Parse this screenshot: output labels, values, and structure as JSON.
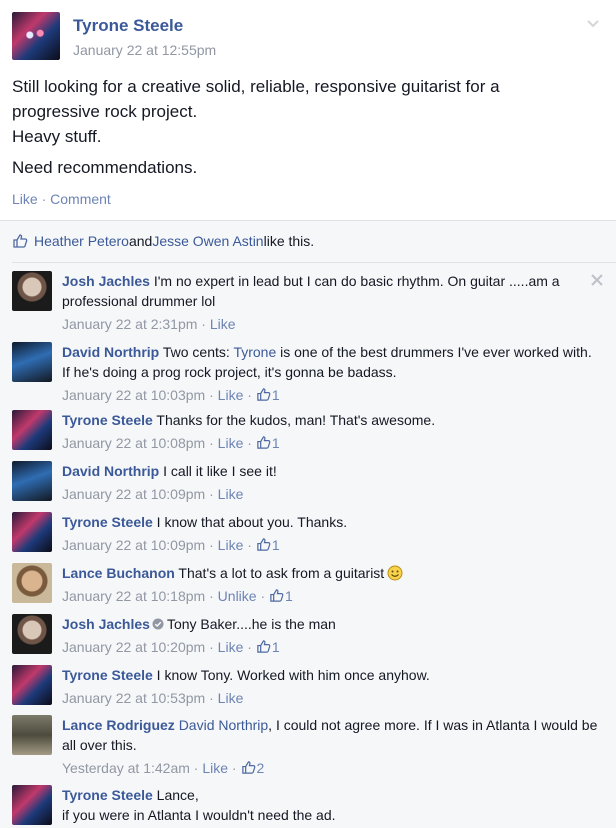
{
  "post": {
    "author": "Tyrone Steele",
    "timestamp": "January 22 at 12:55pm",
    "text_line1": "Still looking for a creative solid, reliable, responsive guitarist for a",
    "text_line2": "progressive rock project.",
    "text_line3": "Heavy stuff.",
    "text_line4": "Need recommendations.",
    "like_label": "Like",
    "dot": " · ",
    "comment_label": "Comment"
  },
  "likes": {
    "name1": "Heather Petero",
    "and": " and ",
    "name2": "Jesse Owen Astin",
    "suffix": " like this."
  },
  "comments": [
    {
      "author": "Josh Jachles",
      "text": " I'm no expert in lead but I can do basic rhythm. On guitar .....am a professional drummer lol",
      "time": "January 22 at 2:31pm",
      "action": "Like",
      "likes": ""
    },
    {
      "author": "David Northrip",
      "text_pre": " Two cents: ",
      "mention": "Tyrone",
      "text_post": " is one of the best drummers I've ever worked with. If he's doing a prog rock project, it's gonna be badass.",
      "time": "January 22 at 10:03pm",
      "action": "Like",
      "likes": "1"
    },
    {
      "author": "Tyrone Steele",
      "text": " Thanks for the kudos, man! That's awesome.",
      "time": "January 22 at 10:08pm",
      "action": "Like",
      "likes": "1"
    },
    {
      "author": "David Northrip",
      "text": " I call it like I see it!",
      "time": "January 22 at 10:09pm",
      "action": "Like",
      "likes": ""
    },
    {
      "author": "Tyrone Steele",
      "text": " I know that about you. Thanks.",
      "time": "January 22 at 10:09pm",
      "action": "Like",
      "likes": "1"
    },
    {
      "author": "Lance Buchanon",
      "text": " That's a lot to ask from a guitarist",
      "time": "January 22 at 10:18pm",
      "action": "Unlike",
      "likes": "1"
    },
    {
      "author": "Josh Jachles",
      "text": "Tony Baker....he is the man",
      "time": "January 22 at 10:20pm",
      "action": "Like",
      "likes": "1"
    },
    {
      "author": "Tyrone Steele",
      "text": " I know Tony. Worked with him once anyhow.",
      "time": "January 22 at 10:53pm",
      "action": "Like",
      "likes": ""
    },
    {
      "author": "Lance Rodriguez",
      "mention": "David Northrip",
      "text_post": ", I could not agree more. If I was in Atlanta I would be all over this.",
      "time": "Yesterday at 1:42am",
      "action": "Like",
      "likes": "2"
    },
    {
      "author": "Tyrone Steele",
      "text_line1": " Lance,",
      "text_line2": "if you were in Atlanta I wouldn't need the ad."
    }
  ],
  "colors": {
    "link": "#3b5998",
    "meta": "#9197a3",
    "action": "#6d84b4",
    "ufi_bg": "#f6f7f9"
  },
  "icons": {
    "options": "chevron-down-icon",
    "like": "thumbs-up-icon",
    "close": "close-icon",
    "verified": "check-circle-icon",
    "smiley": "smiley-emoticon-icon"
  }
}
